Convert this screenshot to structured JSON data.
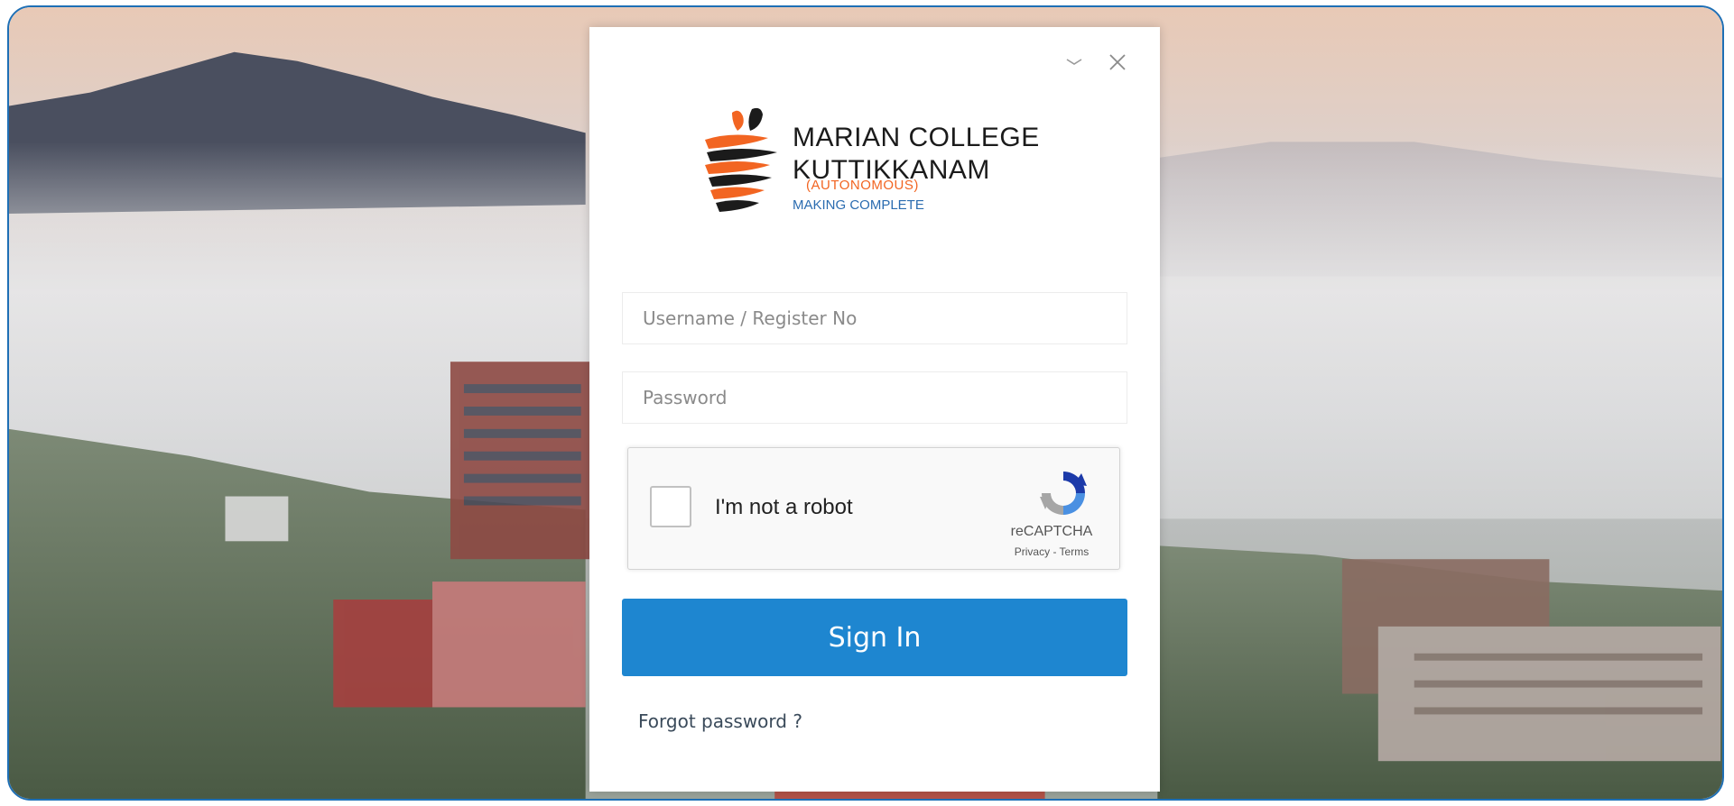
{
  "window_controls": {
    "minimize_icon": "chevron-down-icon",
    "close_icon": "close-icon"
  },
  "logo": {
    "line1": "MARIAN COLLEGE",
    "line2": "KUTTIKKANAM",
    "autonomous": "(AUTONOMOUS)",
    "tagline": "MAKING COMPLETE",
    "colors": {
      "orange": "#f26522",
      "dark": "#1b1b1b",
      "blue": "#2b6cb0"
    }
  },
  "form": {
    "username_placeholder": "Username / Register No",
    "password_placeholder": "Password",
    "username_value": "",
    "password_value": ""
  },
  "captcha": {
    "label": "I'm not a robot",
    "brand": "reCAPTCHA",
    "links": "Privacy - Terms",
    "checked": false
  },
  "actions": {
    "sign_in_label": "Sign In",
    "forgot_label": "Forgot password ?"
  },
  "colors": {
    "accent": "#1e86d0",
    "frame_border": "#1e6fb5"
  }
}
